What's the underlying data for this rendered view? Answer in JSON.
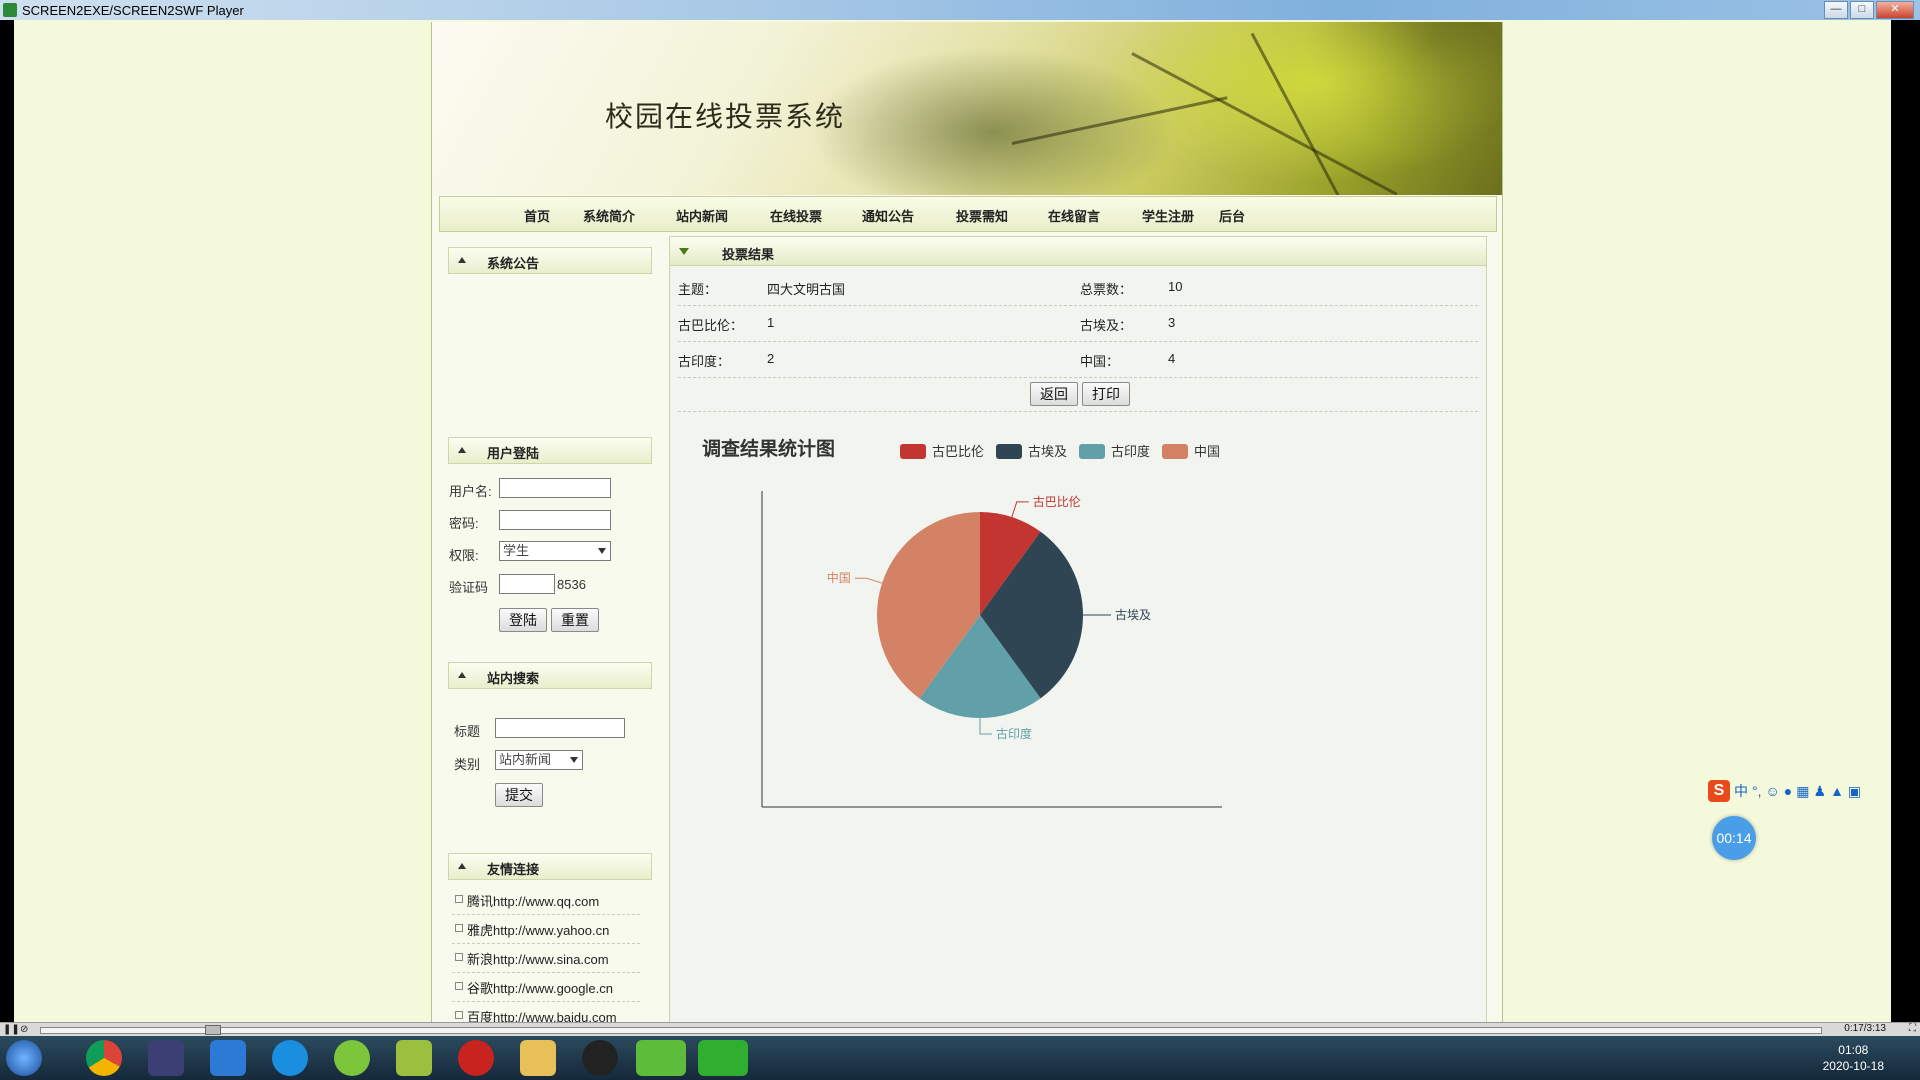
{
  "window": {
    "title": "SCREEN2EXE/SCREEN2SWF Player",
    "min": "—",
    "max": "□",
    "close": "✕"
  },
  "site": {
    "title": "校园在线投票系统"
  },
  "nav": [
    "首页",
    "系统简介",
    "站内新闻",
    "在线投票",
    "通知公告",
    "投票需知",
    "在线留言",
    "学生注册",
    "后台"
  ],
  "sidebar": {
    "notice_title": "系统公告",
    "login": {
      "title": "用户登陆",
      "username_label": "用户名:",
      "password_label": "密码:",
      "role_label": "权限:",
      "role_value": "学生",
      "captcha_label": "验证码",
      "captcha_code": "8536",
      "login_btn": "登陆",
      "reset_btn": "重置"
    },
    "search": {
      "title": "站内搜索",
      "title_label": "标题",
      "category_label": "类别",
      "category_value": "站内新闻",
      "submit_btn": "提交"
    },
    "links": {
      "title": "友情连接",
      "items": [
        "腾讯http://www.qq.com",
        "雅虎http://www.yahoo.cn",
        "新浪http://www.sina.com",
        "谷歌http://www.google.cn",
        "百度http://www.baidu.com"
      ]
    }
  },
  "result": {
    "title": "投票结果",
    "subject_label": "主题：",
    "subject": "四大文明古国",
    "total_label": "总票数：",
    "total": "10",
    "rows": [
      {
        "l_label": "古巴比伦：",
        "l_value": "1",
        "r_label": "古埃及：",
        "r_value": "3"
      },
      {
        "l_label": "古印度：",
        "l_value": "2",
        "r_label": "中国：",
        "r_value": "4"
      }
    ],
    "back_btn": "返回",
    "print_btn": "打印"
  },
  "chart_data": {
    "type": "pie",
    "title": "调查结果统计图",
    "legend_position": "top",
    "categories": [
      "古巴比伦",
      "古埃及",
      "古印度",
      "中国"
    ],
    "values": [
      1,
      3,
      2,
      4
    ],
    "colors": [
      "#c23531",
      "#2f4554",
      "#61a0a8",
      "#d48265"
    ]
  },
  "player": {
    "time": "0:17/3:13"
  },
  "overlay": {
    "timer": "00:14",
    "ime_brand": "S",
    "ime_mode": "中"
  },
  "taskbar": {
    "time": "01:08",
    "date": "2020-10-18"
  }
}
